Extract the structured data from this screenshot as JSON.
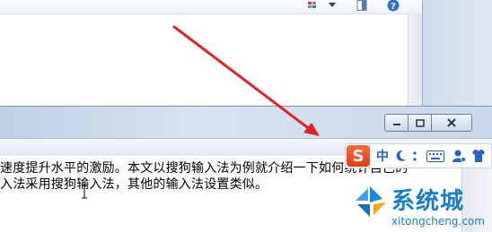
{
  "document": {
    "line1": "速度提升水平的激励。本文以搜狗输入法为例就介绍一下如何统计自己的",
    "line2": "入法采用搜狗输入法，其他的输入法设置类似。"
  },
  "ime": {
    "logo_letter": "S",
    "mode_label": "中",
    "icons": [
      "moon-icon",
      "punctuation-icon",
      "keyboard-icon",
      "user-icon",
      "skin-icon"
    ]
  },
  "watermark": {
    "title": "系统城",
    "url": "xitongcheng.com"
  },
  "colors": {
    "arrow": "#e02424",
    "sogou_orange": "#e84a1c",
    "watermark_blue": "#1a7fc8"
  }
}
